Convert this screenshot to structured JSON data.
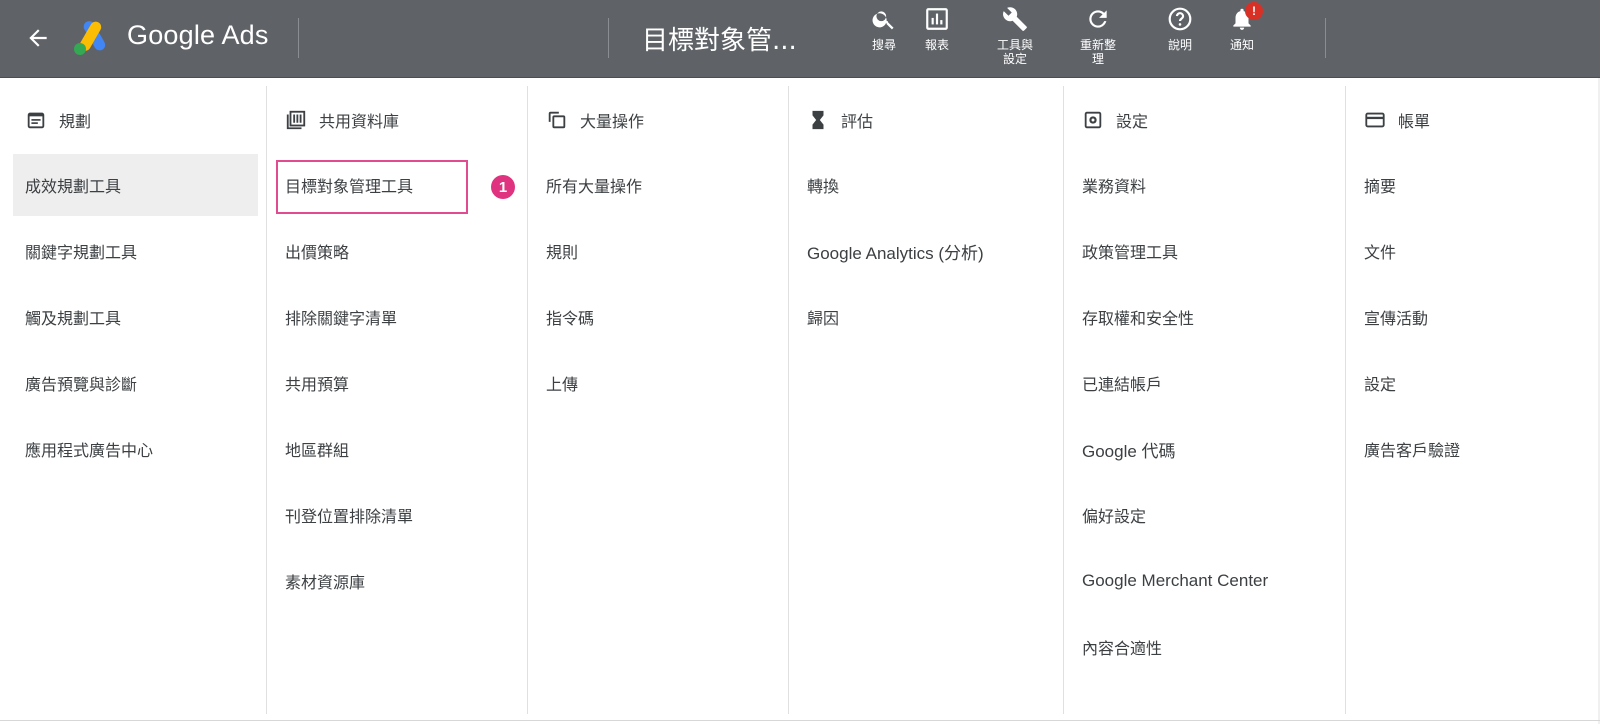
{
  "topbar": {
    "brand": "Google Ads",
    "page_title": "目標對象管...",
    "buttons": [
      {
        "label": "搜尋",
        "icon": "search-icon"
      },
      {
        "label": "報表",
        "icon": "reports-icon"
      },
      {
        "label": "工具與\n設定",
        "icon": "wrench-icon"
      },
      {
        "label": "重新整\n理",
        "icon": "refresh-icon"
      },
      {
        "label": "說明",
        "icon": "help-icon"
      },
      {
        "label": "通知",
        "icon": "bell-icon",
        "badge": "!"
      }
    ]
  },
  "menu": {
    "columns": [
      {
        "header": "規劃",
        "icon": "calendar-icon",
        "items": [
          "成效規劃工具",
          "關鍵字規劃工具",
          "觸及規劃工具",
          "廣告預覽與診斷",
          "應用程式廣告中心"
        ],
        "active_index": 0
      },
      {
        "header": "共用資料庫",
        "icon": "library-icon",
        "items": [
          "目標對象管理工具",
          "出價策略",
          "排除關鍵字清單",
          "共用預算",
          "地區群組",
          "刊登位置排除清單",
          "素材資源庫"
        ]
      },
      {
        "header": "大量操作",
        "icon": "bulk-actions-icon",
        "items": [
          "所有大量操作",
          "規則",
          "指令碼",
          "上傳"
        ]
      },
      {
        "header": "評估",
        "icon": "hourglass-icon",
        "items": [
          "轉換",
          "Google Analytics (分析)",
          "歸因"
        ]
      },
      {
        "header": "設定",
        "icon": "settings-icon",
        "items": [
          "業務資料",
          "政策管理工具",
          "存取權和安全性",
          "已連結帳戶",
          "Google 代碼",
          "偏好設定",
          "Google Merchant Center",
          "內容合適性"
        ]
      },
      {
        "header": "帳單",
        "icon": "billing-card-icon",
        "items": [
          "摘要",
          "文件",
          "宣傳活動",
          "設定",
          "廣告客戶驗證"
        ]
      }
    ]
  },
  "annotation": {
    "step": "1"
  },
  "colors": {
    "topbar": "#5f6368",
    "highlight": "#e04c8f",
    "active_bg": "#eeeeee"
  }
}
